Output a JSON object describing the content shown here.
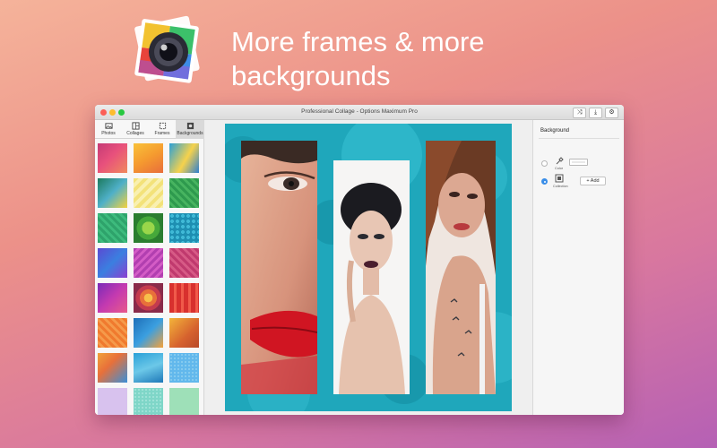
{
  "headline": {
    "line1": "More frames & more",
    "line2": "backgrounds"
  },
  "window": {
    "title": "Professional Collage - Options Maximum Pro",
    "toolbar": {
      "shuffle_icon": "⤨",
      "export_icon": "⤓",
      "settings_icon": "⚙"
    }
  },
  "left_panel": {
    "tabs": [
      {
        "label": "Photos",
        "icon": "photos-icon"
      },
      {
        "label": "Collages",
        "icon": "collages-icon"
      },
      {
        "label": "Frames",
        "icon": "frames-icon"
      },
      {
        "label": "Backgrounds",
        "icon": "backgrounds-icon",
        "active": true
      }
    ]
  },
  "right_panel": {
    "title": "Background",
    "options": [
      {
        "label": "Color",
        "selected": false
      },
      {
        "label": "Collection",
        "selected": true
      }
    ],
    "add_button": "+ Add"
  },
  "colors": {
    "accent": "#3a8ee8",
    "collage_background": "#1fa7bb"
  }
}
